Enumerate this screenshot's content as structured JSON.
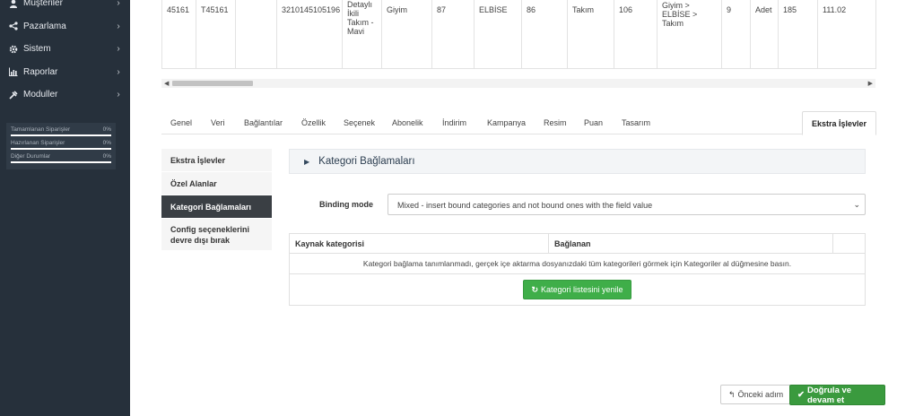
{
  "sidebar": {
    "items": [
      {
        "label": "Müşteriler",
        "icon": "user-icon"
      },
      {
        "label": "Pazarlama",
        "icon": "share-icon"
      },
      {
        "label": "Sistem",
        "icon": "gear-icon"
      },
      {
        "label": "Raporlar",
        "icon": "bar-chart-icon"
      },
      {
        "label": "Moduller",
        "icon": "puzzle-icon"
      }
    ],
    "stats": [
      {
        "label": "Tamamlanan Siparişler",
        "value": "0%"
      },
      {
        "label": "Hazırlanan Siparişler",
        "value": "0%"
      },
      {
        "label": "Diğer Durumlar",
        "value": "0%"
      }
    ]
  },
  "product_row": [
    "45161",
    "T45161",
    "",
    "3210145105196",
    "Detaylı İkili Takım - Mavi",
    "Giyim",
    "87",
    "ELBİSE",
    "86",
    "Takım",
    "106",
    "Giyim > ELBİSE > Takım",
    "9",
    "Adet",
    "185",
    "111.02"
  ],
  "tabs": [
    "Genel",
    "Veri",
    "Bağlantılar",
    "Özellik",
    "Seçenek",
    "Abonelik",
    "İndirim",
    "Kampanya",
    "Resim",
    "Puan",
    "Tasarım",
    "Ekstra İşlevler"
  ],
  "left_menu": [
    "Ekstra İşlevler",
    "Özel Alanlar",
    "Kategori Bağlamaları",
    "Config seçeneklerini devre dışı bırak"
  ],
  "section": {
    "title": "Kategori Bağlamaları",
    "binding_label": "Binding mode",
    "binding_value": "Mixed - insert bound categories and not bound ones with the field value",
    "col_source": "Kaynak kategorisi",
    "col_bound": "Bağlanan",
    "empty_message": "Kategori bağlama tanımlanmadı, gerçek içe aktarma dosyanızdaki tüm kategorileri görmek için Kategoriler al düğmesine basın.",
    "refresh_button": "Kategori listesini yenile"
  },
  "footer": {
    "prev_button": "Önceki adım",
    "next_button": "Doğrula ve devam et"
  }
}
